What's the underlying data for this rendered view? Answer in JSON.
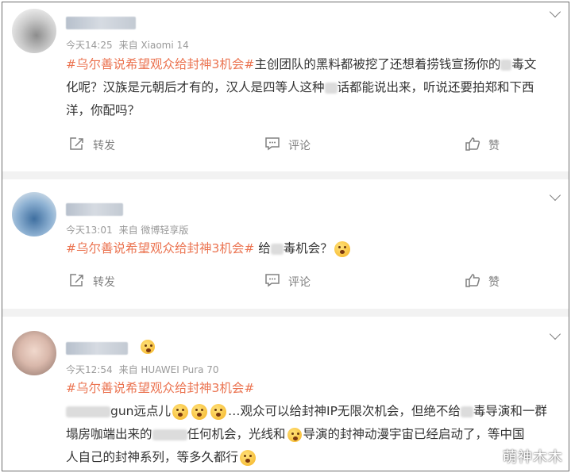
{
  "posts": [
    {
      "time": "今天14:25",
      "source": "来自 Xiaomi 14",
      "lines": [
        {
          "tag": "#乌尔善说希望观众给封神3机会#",
          "t1": "主创团队的黑料都被挖了还想着捞钱宣扬你的",
          "t2": "毒文"
        },
        {
          "t1": "化呢？汉族是元朝后才有的，汉人是四等人这种",
          "t2": "话都能说出来，听说还要拍郑和下西"
        },
        {
          "t1": "洋，你配吗？"
        }
      ]
    },
    {
      "time": "今天13:01",
      "source": "来自 微博轻享版",
      "lines": [
        {
          "tag": "#乌尔善说希望观众给封神3机会#",
          "t1": " 给",
          "t2": "毒机会？"
        }
      ]
    },
    {
      "time": "今天12:54",
      "source": "来自 HUAWEI Pura 70",
      "lines": [
        {
          "tag": "#乌尔善说希望观众给封神3机会#"
        },
        {
          "t1": "gun远点儿",
          "t2": "…观众可以给封神IP无限次机会，但绝不给",
          "t3": "毒导演和一群"
        },
        {
          "t1": "塌房咖端出来的",
          "t2": "任何机会，光线和",
          "t3": "导演的封神动漫宇宙已经启动了，等中国"
        },
        {
          "t1": "人自己的封神系列，等多久都行"
        }
      ]
    }
  ],
  "actions": {
    "repost": "转发",
    "comment": "评论",
    "like": "赞"
  },
  "watermark": "萌神木木",
  "colors": {
    "topic": "#eb7350",
    "meta": "#9a9a9a",
    "action": "#808080",
    "separator": "#f2f2f2"
  }
}
